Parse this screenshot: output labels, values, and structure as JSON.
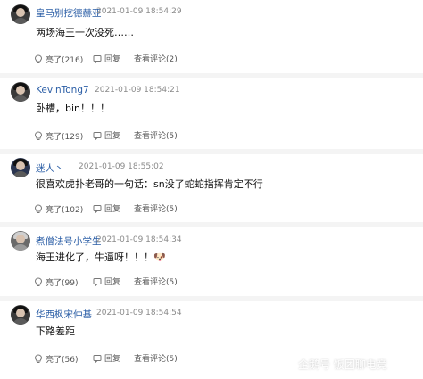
{
  "comments": [
    {
      "username": "皇马别挖德赫亚",
      "time": "2021-01-09 18:54:29",
      "content": "两场海王一次没死……",
      "like_label": "亮了(216)",
      "reply_label": "回复",
      "view_label": "查看评论(2)"
    },
    {
      "username": "KevinTong7",
      "time": "2021-01-09 18:54:21",
      "content": "卧槽，bin！！！",
      "like_label": "亮了(129)",
      "reply_label": "回复",
      "view_label": "查看评论(5)"
    },
    {
      "username": "迷人丶",
      "time": "2021-01-09 18:55:02",
      "content": "很喜欢虎扑老哥的一句话：sn没了蛇蛇指挥肯定不行",
      "like_label": "亮了(102)",
      "reply_label": "回复",
      "view_label": "查看评论(5)"
    },
    {
      "username": "煮僧法号小学生",
      "time": "2021-01-09 18:54:34",
      "content": "海王进化了，牛逼呀！！！🐶",
      "like_label": "亮了(99)",
      "reply_label": "回复",
      "view_label": "查看评论(5)"
    },
    {
      "username": "华西枫宋仲基",
      "time": "2021-01-09 18:54:54",
      "content": "下路差距",
      "like_label": "亮了(56)",
      "reply_label": "回复",
      "view_label": "查看评论(5)"
    }
  ],
  "watermark": "企鹅号 饭团聊电竞",
  "icons": {
    "like": "bulb-icon",
    "reply": "reply-icon",
    "view": "comment-icon"
  },
  "colors": {
    "username": "#2b5ea6",
    "timestamp": "#8a8a8a",
    "separator_band": "#f4f4f4"
  }
}
